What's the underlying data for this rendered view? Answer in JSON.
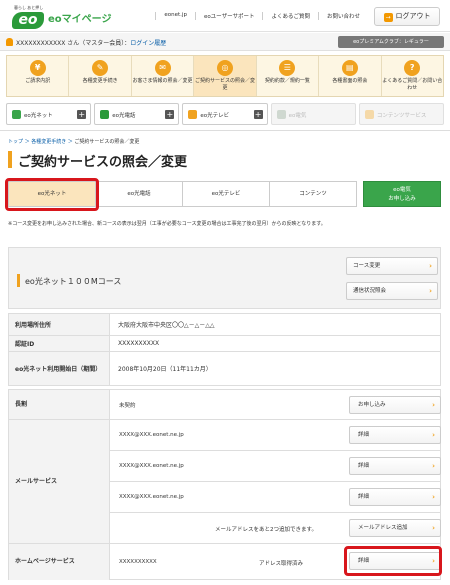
{
  "header": {
    "logo_tag": "暮らし あと押し",
    "logo_text": "eo",
    "site_title": "eoマイページ",
    "nav": [
      "eonet.jp",
      "eoユーザーサポート",
      "よくあるご質問",
      "お問い合わせ"
    ],
    "logout_label": "ログアウト",
    "logout_icon": "logout-icon"
  },
  "userbar": {
    "name": "XXXXXXXXXXXX さん（マスター会員）",
    "login_history": "ログイン履歴",
    "premium_label": "eoプレミアムクラブ：レギュラー"
  },
  "main_menu": [
    {
      "label": "ご請求内訳",
      "icon": "¥"
    },
    {
      "label": "各種変更手続き",
      "icon": "✎"
    },
    {
      "label": "お客さま情報の照会／変更",
      "icon": "✉"
    },
    {
      "label": "ご契約サービスの照会／変更",
      "icon": "◎"
    },
    {
      "label": "契約約款／規約一覧",
      "icon": "☰"
    },
    {
      "label": "各種書面の照会",
      "icon": "▤"
    },
    {
      "label": "よくあるご質問／お問い合わせ",
      "icon": "?"
    }
  ],
  "services": [
    {
      "label": "eo光ネット",
      "color": "#3aa54b"
    },
    {
      "label": "eo光電話",
      "color": "#2b9a3a"
    },
    {
      "label": "eo光テレビ",
      "color": "#f0a21f"
    },
    {
      "label": "eo電気",
      "color": "#cfd8d0"
    },
    {
      "label": "コンテンツサービス",
      "color": "#f5d9a8"
    }
  ],
  "breadcrumb": {
    "items": [
      "トップ",
      "各種変更手続き"
    ],
    "current": "ご契約サービスの照会／変更"
  },
  "page_title": "ご契約サービスの照会／変更",
  "tabs": [
    "eo光ネット",
    "eo光電話",
    "eo光テレビ",
    "コンテンツ"
  ],
  "tab_green": {
    "line1": "eo電気",
    "line2": "お申し込み"
  },
  "notice": "※コース変更をお申し込みされた場合、新コースの表示は翌月（工事が必要なコース変更の場合は工事完了後の翌月）からの反映となります。",
  "course": {
    "name": "eo光ネット１００Mコース",
    "change_button": "コース変更",
    "status_button": "通信状況照会"
  },
  "info": [
    {
      "label": "利用場所住所",
      "value": "大阪府大阪市中央区〇〇△－△－△△"
    },
    {
      "label": "認証ID",
      "value": "XXXXXXXXXX"
    },
    {
      "label": "eo光ネット利用開始日（期間）",
      "value": "2008年10月20日（11年11カ月）"
    }
  ],
  "contract": {
    "long_term": {
      "label": "長割",
      "value": "未契約",
      "button": "お申し込み"
    },
    "mail": {
      "label": "メールサービス",
      "addresses": [
        "XXXX@XXX.eonet.ne.jp",
        "XXXX@XXX.eonet.ne.jp",
        "XXXX@XXX.eonet.ne.jp"
      ],
      "detail_button": "詳細",
      "more_text": "メールアドレスをあと2つ追加できます。",
      "add_button": "メールアドレス追加"
    },
    "homepage": {
      "label": "ホームページサービス",
      "value": "XXXXXXXXXX",
      "status": "アドレス取得済み",
      "button": "詳細"
    }
  },
  "colors": {
    "accent": "#f0a21f",
    "brand_green": "#3aa54b",
    "highlight": "#d8161c"
  }
}
